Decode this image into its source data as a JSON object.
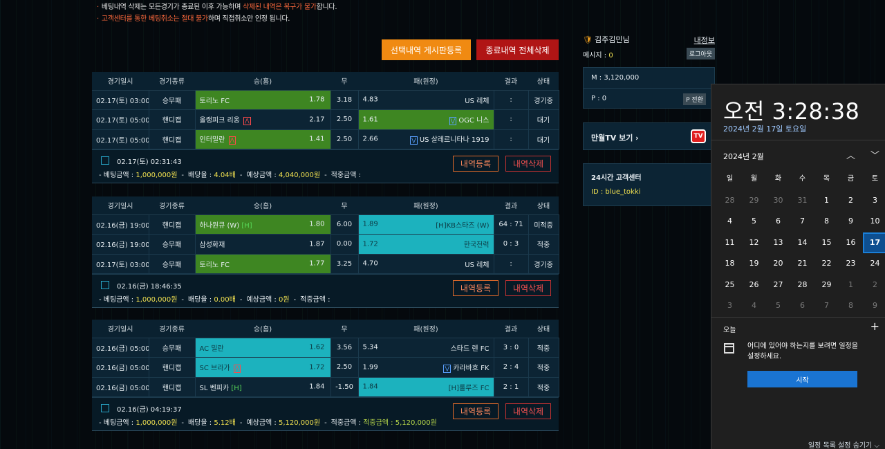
{
  "notice": {
    "line1": [
      {
        "t": "베팅내역 삭제는 모든경기가 종료된 이후 가능하며 ",
        "hl": false
      },
      {
        "t": "삭제된 내역은 복구가 불가",
        "hl": true
      },
      {
        "t": "합니다.",
        "hl": false
      }
    ],
    "line2": [
      {
        "t": "고객센터를 통한 베팅취소는 절대 불가",
        "hl": true
      },
      {
        "t": "하며 직접취소만 인정 됩니다.",
        "hl": false
      }
    ]
  },
  "buttons": {
    "board_register": "선택내역 게시판등록",
    "delete_finished": "종료내역 전체삭제"
  },
  "columns": [
    "경기일시",
    "경기종류",
    "승(홈)",
    "무",
    "패(원정)",
    "결과",
    "상태"
  ],
  "bets": [
    {
      "rows": [
        {
          "time": "02.17(토) 03:00",
          "type": "승무패",
          "home": "토리노 FC",
          "home_mark": "",
          "home_odds": "1.78",
          "draw": "3.18",
          "away": "US 레체",
          "away_mark": "",
          "away_odds": "4.83",
          "result": ":",
          "status": "경기중",
          "sel": "home",
          "selcolor": "green"
        },
        {
          "time": "02.17(토) 05:00",
          "type": "핸디캡",
          "home": "올랭피크 리옹",
          "home_mark": "up",
          "home_odds": "2.17",
          "draw": "2.50",
          "away": "OGC 니스",
          "away_mark": "down",
          "away_odds": "1.61",
          "result": ":",
          "status": "대기",
          "sel": "away",
          "selcolor": "green"
        },
        {
          "time": "02.17(토) 05:00",
          "type": "핸디캡",
          "home": "인터밀란",
          "home_mark": "up",
          "home_odds": "1.41",
          "draw": "2.50",
          "away": "US 살레르니타나 1919",
          "away_mark": "down",
          "away_odds": "2.66",
          "result": ":",
          "status": "대기",
          "sel": "home",
          "selcolor": "green"
        }
      ],
      "datetime": "02.17(토) 02:31:43",
      "amount": "1,000,000원",
      "rate": "4.04배",
      "expected": "4,040,000원",
      "hit": ""
    },
    {
      "rows": [
        {
          "time": "02.16(금) 19:00",
          "type": "핸디캡",
          "home": "하나원큐 (W)",
          "home_mark": "H",
          "home_odds": "1.80",
          "draw": "6.00",
          "away": "KB스타즈 (W)",
          "away_mark": "H",
          "away_odds": "1.89",
          "result": "64 : 71",
          "status": "미적중",
          "sel": "both",
          "selcolor": "green"
        },
        {
          "time": "02.16(금) 19:00",
          "type": "승무패",
          "home": "삼성화재",
          "home_mark": "",
          "home_odds": "1.87",
          "draw": "0.00",
          "away": "한국전력",
          "away_mark": "",
          "away_odds": "1.72",
          "result": "0 : 3",
          "status": "적중",
          "sel": "away",
          "selcolor": "cyan"
        },
        {
          "time": "02.17(토) 03:00",
          "type": "승무패",
          "home": "토리노 FC",
          "home_mark": "",
          "home_odds": "1.77",
          "draw": "3.25",
          "away": "US 레체",
          "away_mark": "",
          "away_odds": "4.70",
          "result": ":",
          "status": "경기중",
          "sel": "home",
          "selcolor": "green"
        }
      ],
      "datetime": "02.16(금) 18:46:35",
      "amount": "1,000,000원",
      "rate": "0.00배",
      "expected": "0원",
      "hit": ""
    },
    {
      "rows": [
        {
          "time": "02.16(금) 05:00",
          "type": "승무패",
          "home": "AC 밀란",
          "home_mark": "",
          "home_odds": "1.62",
          "draw": "3.56",
          "away": "스타드 렌 FC",
          "away_mark": "",
          "away_odds": "5.34",
          "result": "3 : 0",
          "status": "적중",
          "sel": "home",
          "selcolor": "cyan"
        },
        {
          "time": "02.16(금) 05:00",
          "type": "핸디캡",
          "home": "SC 브라가",
          "home_mark": "up",
          "home_odds": "1.72",
          "draw": "2.50",
          "away": "카라바흐 FK",
          "away_mark": "down",
          "away_odds": "1.99",
          "result": "2 : 4",
          "status": "적중",
          "sel": "home",
          "selcolor": "cyan"
        },
        {
          "time": "02.16(금) 05:00",
          "type": "핸디캡",
          "home": "SL 벤피카",
          "home_mark": "H",
          "home_odds": "1.84",
          "draw": "-1.50",
          "away": "룰루즈 FC",
          "away_mark": "H",
          "away_odds": "1.84",
          "result": "2 : 1",
          "status": "적중",
          "sel": "away",
          "selcolor": "cyan"
        }
      ],
      "datetime": "02.16(금) 04:19:37",
      "amount": "1,000,000원",
      "rate": "5.12배",
      "expected": "5,120,000원",
      "hit": "적중금액 : 5,120,000원"
    }
  ],
  "summary_labels": {
    "amount": "베팅금액 : ",
    "rate": "배당율 : ",
    "expected": "예상금액 : ",
    "hit": "적중금액 : ",
    "register": "내역등록",
    "delete": "내역삭제"
  },
  "sidebar": {
    "username": "김주김민님",
    "myinfo": "내정보",
    "message_label": "메시지 : ",
    "message_count": "0",
    "logout": "로그아웃",
    "money": "M : 3,120,000",
    "point": "P : 0",
    "point_convert": "P 전환",
    "tv": "만월TV 보기  ›",
    "tv_icon": "TV",
    "cs_title": "24시간 고객센터",
    "cs_id": "ID : blue_tokki"
  },
  "clock": {
    "time": "오전 3:28:38",
    "date": "2024년 2월 17일 토요일",
    "month": "2024년 2월",
    "weekdays": [
      "일",
      "월",
      "화",
      "수",
      "목",
      "금",
      "토"
    ],
    "weeks": [
      [
        "28",
        "29",
        "30",
        "31",
        "1",
        "2",
        "3"
      ],
      [
        "4",
        "5",
        "6",
        "7",
        "8",
        "9",
        "10"
      ],
      [
        "11",
        "12",
        "13",
        "14",
        "15",
        "16",
        "17"
      ],
      [
        "18",
        "19",
        "20",
        "21",
        "22",
        "23",
        "24"
      ],
      [
        "25",
        "26",
        "27",
        "28",
        "29",
        "1",
        "2"
      ],
      [
        "3",
        "4",
        "5",
        "6",
        "7",
        "8",
        "9"
      ]
    ],
    "today": "오늘",
    "event_text": "어디에 있어야 하는지를 보려면 일정을 설정하세요.",
    "start": "시작",
    "hide_agenda": "일정 목록 설정 숨기기 ⌵"
  }
}
